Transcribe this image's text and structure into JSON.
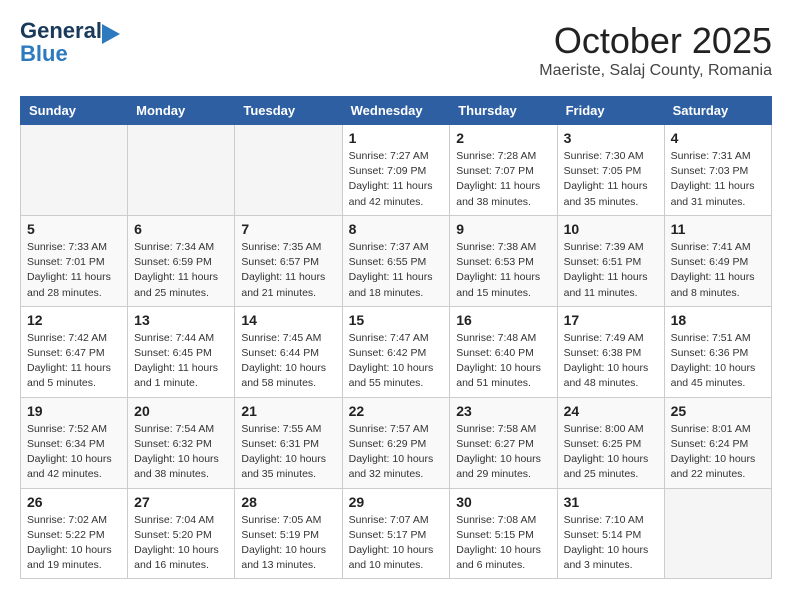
{
  "header": {
    "logo_line1": "General",
    "logo_line2": "Blue",
    "month": "October 2025",
    "location": "Maeriste, Salaj County, Romania"
  },
  "weekdays": [
    "Sunday",
    "Monday",
    "Tuesday",
    "Wednesday",
    "Thursday",
    "Friday",
    "Saturday"
  ],
  "weeks": [
    [
      {
        "day": "",
        "info": ""
      },
      {
        "day": "",
        "info": ""
      },
      {
        "day": "",
        "info": ""
      },
      {
        "day": "1",
        "info": "Sunrise: 7:27 AM\nSunset: 7:09 PM\nDaylight: 11 hours\nand 42 minutes."
      },
      {
        "day": "2",
        "info": "Sunrise: 7:28 AM\nSunset: 7:07 PM\nDaylight: 11 hours\nand 38 minutes."
      },
      {
        "day": "3",
        "info": "Sunrise: 7:30 AM\nSunset: 7:05 PM\nDaylight: 11 hours\nand 35 minutes."
      },
      {
        "day": "4",
        "info": "Sunrise: 7:31 AM\nSunset: 7:03 PM\nDaylight: 11 hours\nand 31 minutes."
      }
    ],
    [
      {
        "day": "5",
        "info": "Sunrise: 7:33 AM\nSunset: 7:01 PM\nDaylight: 11 hours\nand 28 minutes."
      },
      {
        "day": "6",
        "info": "Sunrise: 7:34 AM\nSunset: 6:59 PM\nDaylight: 11 hours\nand 25 minutes."
      },
      {
        "day": "7",
        "info": "Sunrise: 7:35 AM\nSunset: 6:57 PM\nDaylight: 11 hours\nand 21 minutes."
      },
      {
        "day": "8",
        "info": "Sunrise: 7:37 AM\nSunset: 6:55 PM\nDaylight: 11 hours\nand 18 minutes."
      },
      {
        "day": "9",
        "info": "Sunrise: 7:38 AM\nSunset: 6:53 PM\nDaylight: 11 hours\nand 15 minutes."
      },
      {
        "day": "10",
        "info": "Sunrise: 7:39 AM\nSunset: 6:51 PM\nDaylight: 11 hours\nand 11 minutes."
      },
      {
        "day": "11",
        "info": "Sunrise: 7:41 AM\nSunset: 6:49 PM\nDaylight: 11 hours\nand 8 minutes."
      }
    ],
    [
      {
        "day": "12",
        "info": "Sunrise: 7:42 AM\nSunset: 6:47 PM\nDaylight: 11 hours\nand 5 minutes."
      },
      {
        "day": "13",
        "info": "Sunrise: 7:44 AM\nSunset: 6:45 PM\nDaylight: 11 hours\nand 1 minute."
      },
      {
        "day": "14",
        "info": "Sunrise: 7:45 AM\nSunset: 6:44 PM\nDaylight: 10 hours\nand 58 minutes."
      },
      {
        "day": "15",
        "info": "Sunrise: 7:47 AM\nSunset: 6:42 PM\nDaylight: 10 hours\nand 55 minutes."
      },
      {
        "day": "16",
        "info": "Sunrise: 7:48 AM\nSunset: 6:40 PM\nDaylight: 10 hours\nand 51 minutes."
      },
      {
        "day": "17",
        "info": "Sunrise: 7:49 AM\nSunset: 6:38 PM\nDaylight: 10 hours\nand 48 minutes."
      },
      {
        "day": "18",
        "info": "Sunrise: 7:51 AM\nSunset: 6:36 PM\nDaylight: 10 hours\nand 45 minutes."
      }
    ],
    [
      {
        "day": "19",
        "info": "Sunrise: 7:52 AM\nSunset: 6:34 PM\nDaylight: 10 hours\nand 42 minutes."
      },
      {
        "day": "20",
        "info": "Sunrise: 7:54 AM\nSunset: 6:32 PM\nDaylight: 10 hours\nand 38 minutes."
      },
      {
        "day": "21",
        "info": "Sunrise: 7:55 AM\nSunset: 6:31 PM\nDaylight: 10 hours\nand 35 minutes."
      },
      {
        "day": "22",
        "info": "Sunrise: 7:57 AM\nSunset: 6:29 PM\nDaylight: 10 hours\nand 32 minutes."
      },
      {
        "day": "23",
        "info": "Sunrise: 7:58 AM\nSunset: 6:27 PM\nDaylight: 10 hours\nand 29 minutes."
      },
      {
        "day": "24",
        "info": "Sunrise: 8:00 AM\nSunset: 6:25 PM\nDaylight: 10 hours\nand 25 minutes."
      },
      {
        "day": "25",
        "info": "Sunrise: 8:01 AM\nSunset: 6:24 PM\nDaylight: 10 hours\nand 22 minutes."
      }
    ],
    [
      {
        "day": "26",
        "info": "Sunrise: 7:02 AM\nSunset: 5:22 PM\nDaylight: 10 hours\nand 19 minutes."
      },
      {
        "day": "27",
        "info": "Sunrise: 7:04 AM\nSunset: 5:20 PM\nDaylight: 10 hours\nand 16 minutes."
      },
      {
        "day": "28",
        "info": "Sunrise: 7:05 AM\nSunset: 5:19 PM\nDaylight: 10 hours\nand 13 minutes."
      },
      {
        "day": "29",
        "info": "Sunrise: 7:07 AM\nSunset: 5:17 PM\nDaylight: 10 hours\nand 10 minutes."
      },
      {
        "day": "30",
        "info": "Sunrise: 7:08 AM\nSunset: 5:15 PM\nDaylight: 10 hours\nand 6 minutes."
      },
      {
        "day": "31",
        "info": "Sunrise: 7:10 AM\nSunset: 5:14 PM\nDaylight: 10 hours\nand 3 minutes."
      },
      {
        "day": "",
        "info": ""
      }
    ]
  ]
}
